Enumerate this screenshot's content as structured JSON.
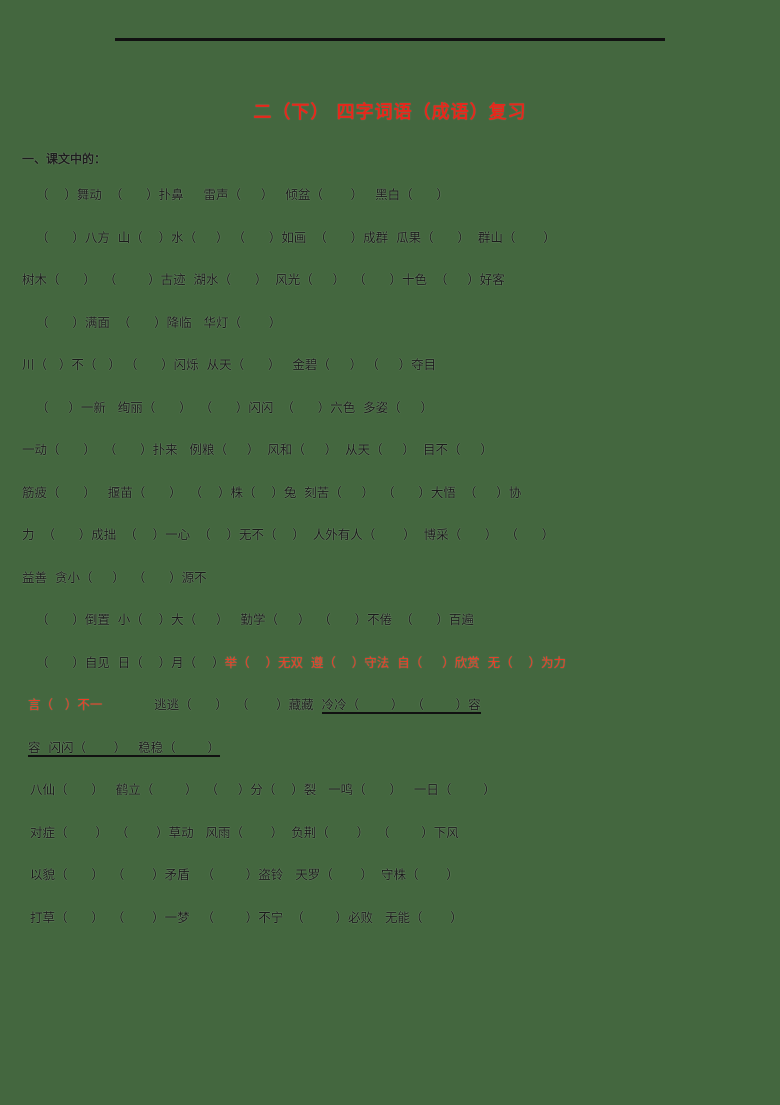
{
  "document": {
    "title": "二（下） 四字词语（成语）复习",
    "title_color": "#e8261a",
    "page_bg": "#44673f",
    "section_heading": "一、课文中的：",
    "lines": [
      {
        "id": "line-1",
        "indent": "ind-1",
        "segments": [
          {
            "text": "（    ）舞动  （      ）扑鼻     雷声（     ）   倾盆（       ）   黑白（      ）",
            "color": "black",
            "underline": false
          }
        ]
      },
      {
        "id": "line-2",
        "indent": "ind-1",
        "segments": [
          {
            "text": "（      ）八方  山（    ）水（     ） （      ）如画  （      ）成群  瓜果（      ）  群山（       ）",
            "color": "black",
            "underline": false
          }
        ]
      },
      {
        "id": "line-3",
        "indent": "ind-2",
        "segments": [
          {
            "text": "树木（      ）  （        ）古迹  湖水（      ）  风光（     ）  （      ）十色  （     ）好客",
            "color": "black",
            "underline": false
          }
        ]
      },
      {
        "id": "line-4",
        "indent": "ind-1",
        "segments": [
          {
            "text": "（      ）满面  （      ）降临   华灯（       ）",
            "color": "black",
            "underline": false
          }
        ]
      },
      {
        "id": "line-5",
        "indent": "ind-2",
        "segments": [
          {
            "text": "川（   ）不（   ） （      ）闪烁  从天（      ）   金碧（     ） （     ）夺目",
            "color": "black",
            "underline": false
          }
        ]
      },
      {
        "id": "line-6",
        "indent": "ind-1",
        "segments": [
          {
            "text": "（     ）一新   绚丽（      ）  （      ）闪闪  （      ）六色  多姿（     ）",
            "color": "black",
            "underline": false
          }
        ]
      },
      {
        "id": "line-7",
        "indent": "ind-2",
        "segments": [
          {
            "text": "一动（      ）  （      ）扑来   例粮（     ）  风和（     ）  从天（     ）  目不（     ）",
            "color": "black",
            "underline": false
          }
        ]
      },
      {
        "id": "line-8",
        "indent": "ind-2",
        "segments": [
          {
            "text": "筋疲（      ）   揠苗（      ）  （    ）株（    ）兔  刻苦（     ）  （      ）大悟  （     ）协",
            "color": "black",
            "underline": false
          }
        ]
      },
      {
        "id": "line-9",
        "indent": "ind-2",
        "segments": [
          {
            "text": "力  （      ）成拙  （    ）一心  （    ）无不（    ）  人外有人（       ）  博采（      ）  （      ）",
            "color": "black",
            "underline": false
          }
        ]
      },
      {
        "id": "line-10",
        "indent": "ind-2",
        "segments": [
          {
            "text": "益善  贪小（     ）  （      ）源不",
            "color": "black",
            "underline": false
          }
        ]
      },
      {
        "id": "line-11",
        "indent": "ind-1",
        "segments": [
          {
            "text": "（      ）倒置  小（    ）大（     ）   勤学（     ）  （      ）不倦  （      ）百遍",
            "color": "black",
            "underline": false
          }
        ]
      },
      {
        "id": "line-12",
        "indent": "ind-1",
        "segments": [
          {
            "text": "（      ）自见  日（    ）月（    ）",
            "color": "black",
            "underline": false
          },
          {
            "text": "举（    ）无双  遵（    ）守法  自（     ）欣赏  无（    ）为力",
            "color": "red",
            "underline": false
          }
        ]
      },
      {
        "id": "line-13",
        "indent": "ind-3",
        "segments": [
          {
            "text": "言（   ）不一",
            "color": "red",
            "underline": false
          },
          {
            "text": "             逃逃（      ）  （       ）藏藏  ",
            "color": "black",
            "underline": false
          },
          {
            "text": "冷冷（        ）  （        ）容",
            "color": "black",
            "underline": true
          }
        ]
      },
      {
        "id": "line-14",
        "indent": "ind-3",
        "segments": [
          {
            "text": "容  闪闪（       ）   稳稳（        ）",
            "color": "black",
            "underline": true
          }
        ]
      },
      {
        "id": "line-15",
        "indent": "ind-4",
        "segments": [
          {
            "text": "八仙（      ）   鹤立（        ）  （     ）分（    ）裂   一鸣（      ）   一日（        ）",
            "color": "black",
            "underline": false
          }
        ]
      },
      {
        "id": "line-16",
        "indent": "ind-4",
        "segments": [
          {
            "text": "对症（       ）  （       ）草动   风雨（       ）  负荆（       ）  （        ）下风",
            "color": "black",
            "underline": false
          }
        ]
      },
      {
        "id": "line-17",
        "indent": "ind-4",
        "segments": [
          {
            "text": "以貌（      ）  （       ）矛盾   （        ）盗铃   天罗（       ）  守株（       ）",
            "color": "black",
            "underline": false
          }
        ]
      },
      {
        "id": "line-18",
        "indent": "ind-4",
        "segments": [
          {
            "text": "打草（      ）  （       ）一梦   （        ）不宁  （        ）必败   无能（       ）",
            "color": "black",
            "underline": false
          }
        ]
      }
    ]
  }
}
